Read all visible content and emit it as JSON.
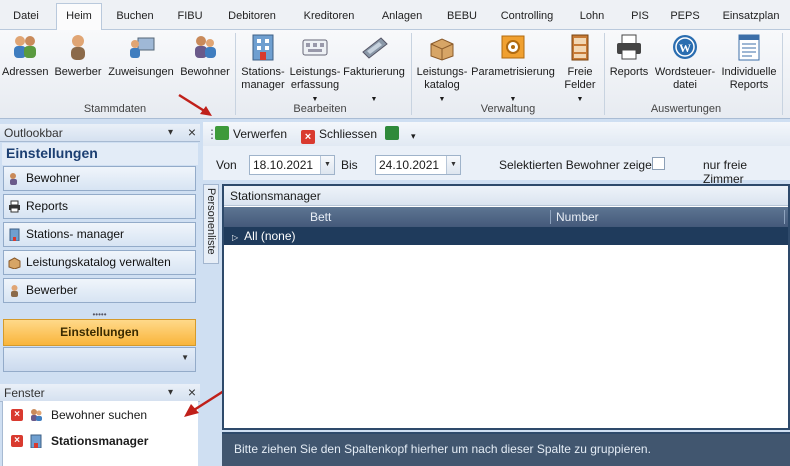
{
  "menu": {
    "tabs": [
      "Datei",
      "Heim",
      "Buchen",
      "FIBU",
      "Debitoren",
      "Kreditoren",
      "Anlagen",
      "BEBU",
      "Controlling",
      "Lohn",
      "PIS",
      "PEPS",
      "Einsatzplan"
    ],
    "active_tab": "Heim"
  },
  "ribbon": {
    "groups": {
      "stammdaten": "Stammdaten",
      "bearbeiten": "Bearbeiten",
      "verwaltung": "Verwaltung",
      "auswertungen": "Auswertungen"
    },
    "buttons": {
      "adressen": "Adressen",
      "bewerber": "Bewerber",
      "zuweisungen": "Zuweisungen",
      "bewohner": "Bewohner",
      "stationsmanager_1": "Stations-",
      "stationsmanager_2": "manager",
      "leistungserfassung_1": "Leistungs-",
      "leistungserfassung_2": "erfassung",
      "fakturierung": "Fakturierung",
      "leistungskatalog_1": "Leistungs-",
      "leistungskatalog_2": "katalog",
      "parametrisierung": "Parametrisierung",
      "freie_felder_1": "Freie",
      "freie_felder_2": "Felder",
      "reports": "Reports",
      "wordsteuerdatei_1": "Wordsteuer-",
      "wordsteuerdatei_2": "datei",
      "individuelle_reports_1": "Individuelle",
      "individuelle_reports_2": "Reports"
    }
  },
  "outlookbar": {
    "header": "Outlookbar",
    "title": "Einstellungen",
    "items": [
      {
        "label": "Bewohner"
      },
      {
        "label": "Reports"
      },
      {
        "label": "Stations- manager"
      },
      {
        "label": "Leistungskatalog verwalten"
      },
      {
        "label": "Bewerber"
      }
    ],
    "active_section": "Einstellungen"
  },
  "fenster": {
    "header": "Fenster",
    "items": [
      {
        "label": "Bewohner suchen"
      },
      {
        "label": "Stationsmanager"
      }
    ]
  },
  "toolbar": {
    "verwerfen": "Verwerfen",
    "schliessen": "Schliessen"
  },
  "filter": {
    "von_label": "Von",
    "von_value": "18.10.2021",
    "bis_label": "Bis",
    "bis_value": "24.10.2021",
    "checkbox_label": "Selektierten Bewohner zeigen",
    "freie_zimmer": "nur freie Zimmer"
  },
  "side_tab": "Personenliste",
  "grid": {
    "title": "Stationsmanager",
    "columns": [
      "Bett",
      "Number"
    ],
    "group_row": "All  (none)",
    "group_hint": "Bitte ziehen Sie den Spaltenkopf hierher um nach dieser Spalte zu gruppieren."
  },
  "colors": {
    "accent_orange": "#f9b53b",
    "grid_header": "#44597a",
    "arrow_red": "#c0201a"
  }
}
